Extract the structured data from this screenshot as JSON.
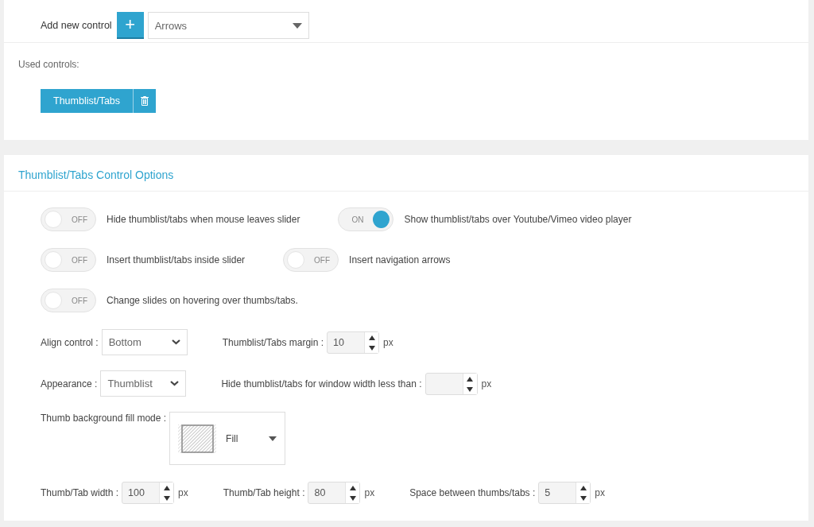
{
  "add_control": {
    "label": "Add new control",
    "button": "+",
    "select_value": "Arrows"
  },
  "used_controls": {
    "label": "Used controls:",
    "items": [
      {
        "label": "Thumblist/Tabs"
      }
    ]
  },
  "options": {
    "title": "Thumblist/Tabs Control Options",
    "toggle_rows": [
      [
        {
          "label": "Hide thumblist/tabs when mouse leaves slider",
          "on": false,
          "state_text": "OFF"
        },
        {
          "label": "Show thumblist/tabs over Youtube/Vimeo video player",
          "on": true,
          "state_text": "ON"
        }
      ],
      [
        {
          "label": "Insert thumblist/tabs inside slider",
          "on": false,
          "state_text": "OFF"
        },
        {
          "label": "Insert navigation arrows",
          "on": false,
          "state_text": "OFF"
        }
      ],
      [
        {
          "label": "Change slides on hovering over thumbs/tabs.",
          "on": false,
          "state_text": "OFF"
        }
      ]
    ],
    "field_rows": [
      [
        {
          "kind": "select",
          "label": "Align control :",
          "value": "Bottom"
        },
        {
          "kind": "number",
          "label": "Thumblist/Tabs margin :",
          "value": "10",
          "unit": "px"
        }
      ],
      [
        {
          "kind": "select",
          "label": "Appearance :",
          "value": "Thumblist"
        },
        {
          "kind": "number",
          "label": "Hide thumblist/tabs for window width less than :",
          "unit": "px"
        }
      ],
      [
        {
          "kind": "fill",
          "label": "Thumb background fill mode :",
          "value": "Fill"
        }
      ],
      [
        {
          "kind": "number",
          "label": "Thumb/Tab width :",
          "value": "100",
          "unit": "px"
        },
        {
          "kind": "number",
          "label": "Thumb/Tab height :",
          "value": "80",
          "unit": "px"
        },
        {
          "kind": "number",
          "label": "Space between thumbs/tabs :",
          "value": "5",
          "unit": "px"
        }
      ]
    ]
  }
}
